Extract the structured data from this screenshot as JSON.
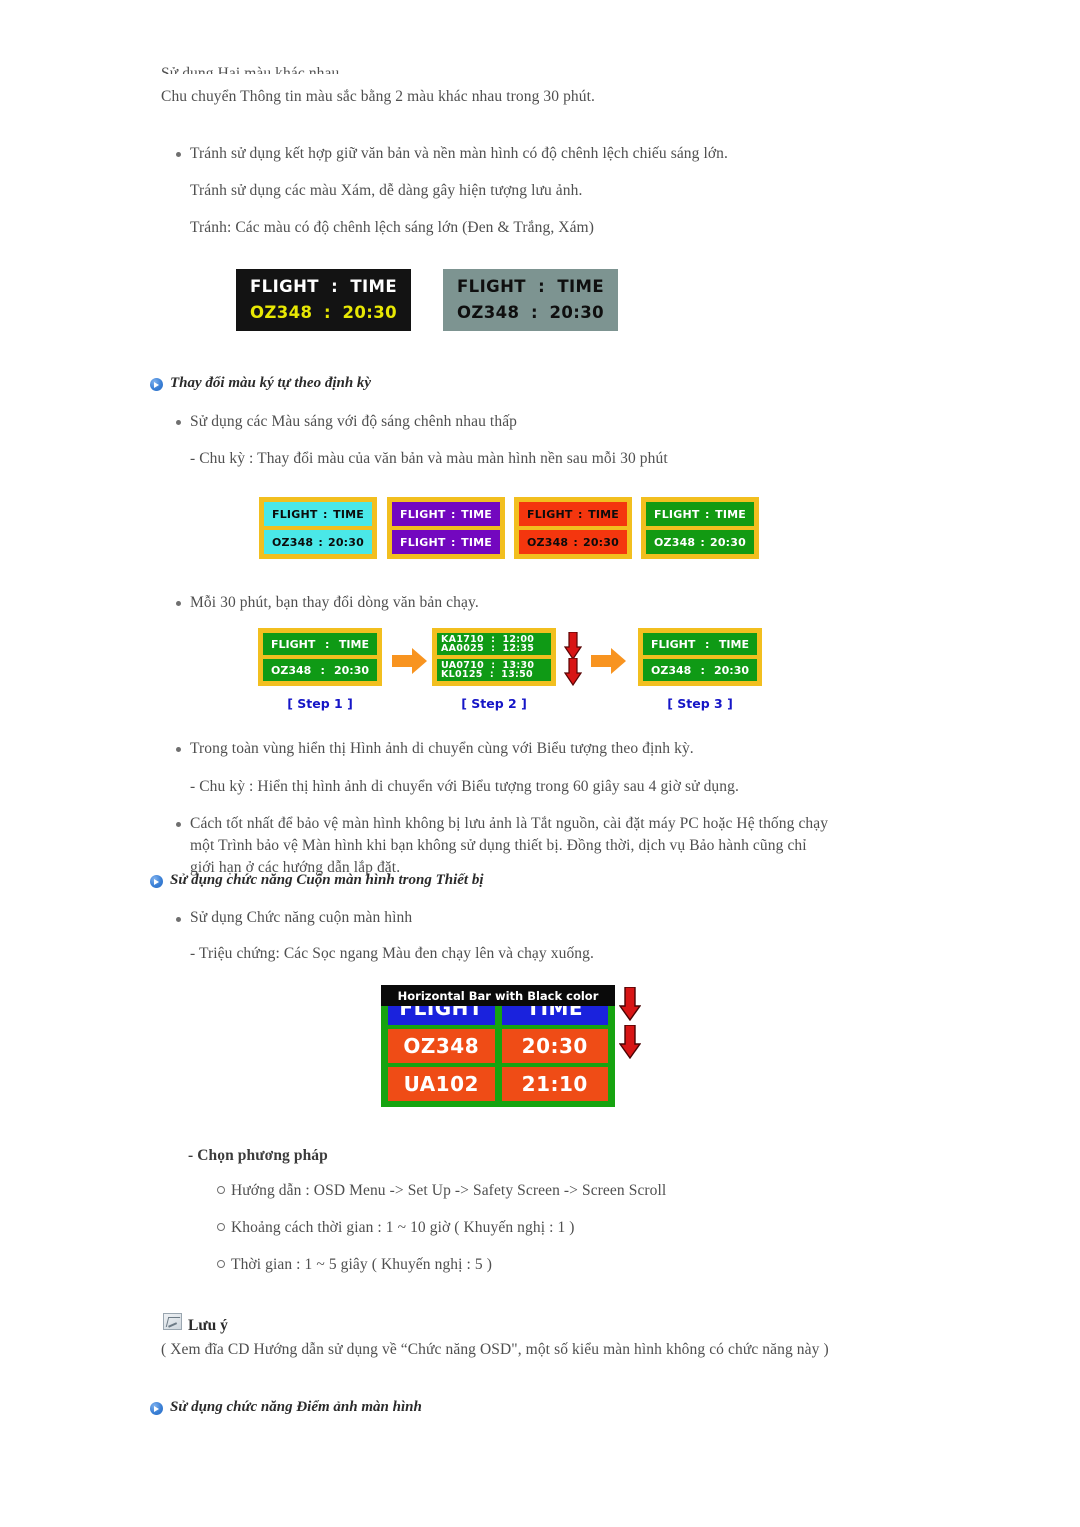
{
  "intro": {
    "line_clipped": "Sử dụng Hai màu khác nhau",
    "line2": "Chu chuyển Thông tin màu sắc bằng 2 màu khác nhau trong 30 phút."
  },
  "bullets_top": {
    "b1": "Tránh sử dụng kết hợp giữ văn bản và nền màn hình có độ chênh lệch chiếu sáng lớn.",
    "b2": "Tránh sử dụng các màu Xám, dễ dàng gây hiện tượng lưu ảnh.",
    "b3": "Tránh: Các màu có độ chênh lệch sáng lớn (Đen & Trắng, Xám)"
  },
  "board_black": {
    "label_flight": "FLIGHT",
    "colon": ":",
    "label_time": "TIME",
    "flight_no": "OZ348",
    "time": "20:30"
  },
  "board_gray": {
    "label_flight": "FLIGHT",
    "colon": ":",
    "label_time": "TIME",
    "flight_no": "OZ348",
    "time": "20:30"
  },
  "section1": {
    "title": "Thay đổi màu ký tự theo định kỳ",
    "bullet1": "Sử dụng các Màu sáng với độ sáng chênh nhau thấp",
    "sub1": "- Chu kỳ : Thay đổi màu của văn bản và màu màn hình nền sau mỗi 30 phút",
    "bullet2": "Mỗi 30 phút, bạn thay đổi dòng văn bản chạy.",
    "bullet3": "Trong toàn vùng hiển thị Hình ảnh di chuyển cùng với Biểu tượng theo định kỳ.",
    "sub2": "- Chu kỳ : Hiển thị hình ảnh di chuyển với Biểu tượng trong 60 giây sau 4 giờ sử dụng.",
    "bullet4": "Cách tốt nhất để bảo vệ màn hình không bị lưu ảnh là Tắt nguồn, cài đặt máy PC hoặc Hệ thống chạy một Trình bảo vệ Màn hình khi bạn không sử dụng thiết bị. Đồng thời, dịch vụ Bảo hành cũng chỉ giới hạn ở các hướng dẫn lắp đặt."
  },
  "color_boards": [
    {
      "bg": "#4ae8e8",
      "text_color": "#0c0c0c",
      "border": "#f2bf1f",
      "top_left": "FLIGHT",
      "top_mid": ":",
      "top_right": "TIME",
      "bot_left": "OZ348",
      "bot_mid": ":",
      "bot_right": "20:30"
    },
    {
      "bg": "#7307bf",
      "text_color": "#ffffff",
      "border": "#f2bf1f",
      "top_left": "FLIGHT",
      "top_mid": ":",
      "top_right": "TIME",
      "bot_left": "FLIGHT",
      "bot_mid": ":",
      "bot_right": "TIME"
    },
    {
      "bg": "#f4360e",
      "text_color": "#0c0c0c",
      "border": "#f2bf1f",
      "top_left": "FLIGHT",
      "top_mid": ":",
      "top_right": "TIME",
      "bot_left": "OZ348",
      "bot_mid": ":",
      "bot_right": "20:30"
    },
    {
      "bg": "#129a12",
      "text_color": "#ffffff",
      "border": "#f2bf1f",
      "top_left": "FLIGHT",
      "top_mid": ":",
      "top_right": "TIME",
      "bot_left": "OZ348",
      "bot_mid": ":",
      "bot_right": "20:30"
    }
  ],
  "steps": [
    {
      "label": "[ Step 1 ]",
      "top_left": "FLIGHT",
      "top_mid": ":",
      "top_right": "TIME",
      "bot_left": "OZ348",
      "bot_mid": ":",
      "bot_right": "20:30"
    },
    {
      "label": "[ Step 2 ]",
      "scroll_top_a": "KA1710  :  12:00",
      "scroll_top_b": "AA0025  :  12:35",
      "scroll_bot_a": "UA0710  :  13:30",
      "scroll_bot_b": "KL0125  :  13:50"
    },
    {
      "label": "[ Step 3 ]",
      "top_left": "FLIGHT",
      "top_mid": ":",
      "top_right": "TIME",
      "bot_left": "OZ348",
      "bot_mid": ":",
      "bot_right": "20:30"
    }
  ],
  "section2": {
    "title": "Sử dụng chức năng Cuộn màn hình trong Thiết bị",
    "bullet1": "Sử dụng Chức năng cuộn màn hình",
    "sub1": "- Triệu chứng: Các Sọc ngang Màu đen chạy lên và chạy xuống."
  },
  "scroll_board": {
    "bar_label": "Horizontal Bar with Black color",
    "r1c1": "FLIGHT",
    "r1c2": "TIME",
    "r2c1": "OZ348",
    "r2c2": "20:30",
    "r3c1": "UA102",
    "r3c2": "21:10"
  },
  "method": {
    "heading": "- Chọn phương pháp",
    "items": [
      "Hướng dẫn : OSD Menu -> Set Up -> Safety Screen -> Screen Scroll",
      "Khoảng cách thời gian : 1 ~ 10 giờ ( Khuyến nghị : 1 )",
      "Thời gian : 1 ~ 5 giây ( Khuyến nghị : 5 )"
    ]
  },
  "note": {
    "title": "Lưu ý",
    "body": "( Xem đĩa CD Hướng dẫn sử dụng về “Chức năng OSD\", một số kiểu màn hình không có chức năng này )"
  },
  "section3": {
    "title": "Sử dụng chức năng Điểm ảnh màn hình"
  }
}
